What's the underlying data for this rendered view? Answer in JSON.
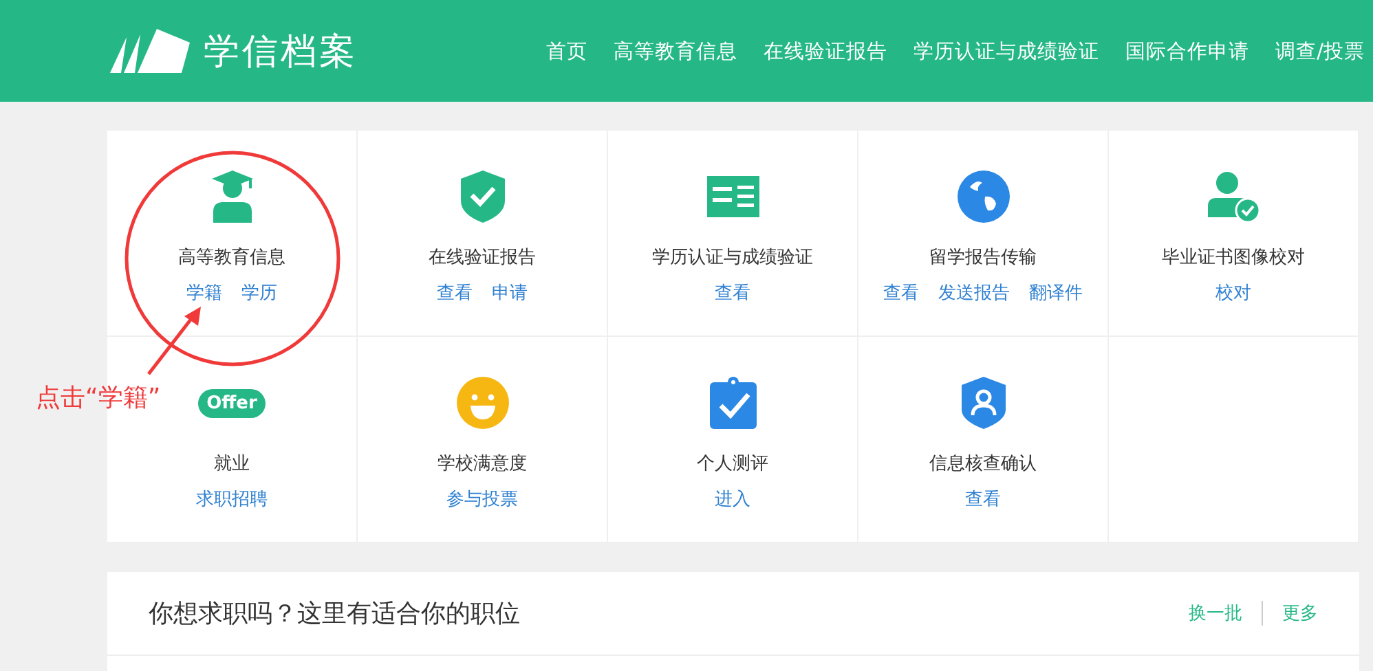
{
  "header": {
    "logo_text": "学信档案",
    "nav": [
      "首页",
      "高等教育信息",
      "在线验证报告",
      "学历认证与成绩验证",
      "国际合作申请",
      "调查/投票"
    ]
  },
  "services": [
    {
      "title": "高等教育信息",
      "links": [
        "学籍",
        "学历"
      ]
    },
    {
      "title": "在线验证报告",
      "links": [
        "查看",
        "申请"
      ]
    },
    {
      "title": "学历认证与成绩验证",
      "links": [
        "查看"
      ]
    },
    {
      "title": "留学报告传输",
      "links": [
        "查看",
        "发送报告",
        "翻译件"
      ]
    },
    {
      "title": "毕业证书图像校对",
      "links": [
        "校对"
      ]
    },
    {
      "title": "就业",
      "links": [
        "求职招聘"
      ],
      "badge": "Offer"
    },
    {
      "title": "学校满意度",
      "links": [
        "参与投票"
      ]
    },
    {
      "title": "个人测评",
      "links": [
        "进入"
      ]
    },
    {
      "title": "信息核查确认",
      "links": [
        "查看"
      ]
    }
  ],
  "annotation": {
    "text": "点击“学籍”"
  },
  "jobs": {
    "title": "你想求职吗？这里有适合你的职位",
    "actions": [
      "换一批",
      "更多"
    ]
  }
}
